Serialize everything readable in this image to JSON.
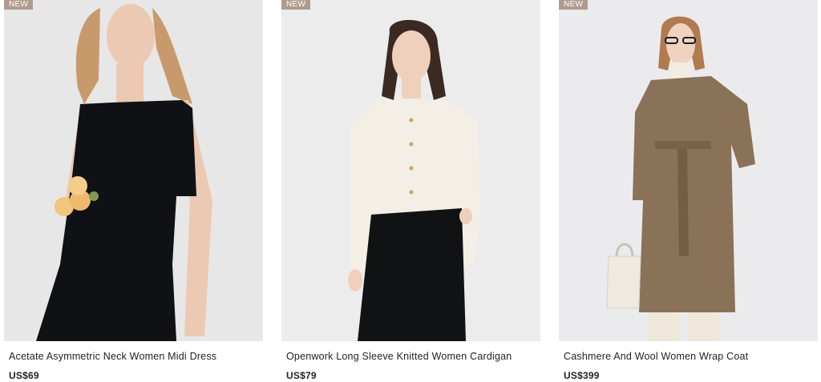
{
  "products": [
    {
      "badge": "NEW",
      "name": "Acetate Asymmetric Neck Women Midi Dress",
      "price": "US$69",
      "image_icon": "black-midi-dress-photo"
    },
    {
      "badge": "NEW",
      "name": "Openwork Long Sleeve Knitted Women Cardigan",
      "price": "US$79",
      "image_icon": "cream-knitted-cardigan-photo"
    },
    {
      "badge": "NEW",
      "name": "Cashmere And Wool Women Wrap Coat",
      "price": "US$399",
      "image_icon": "brown-wrap-coat-photo"
    }
  ],
  "colors": {
    "badge_bg": "#b19b8e",
    "photo_bg": "#e9e9ea",
    "text": "#222222"
  }
}
